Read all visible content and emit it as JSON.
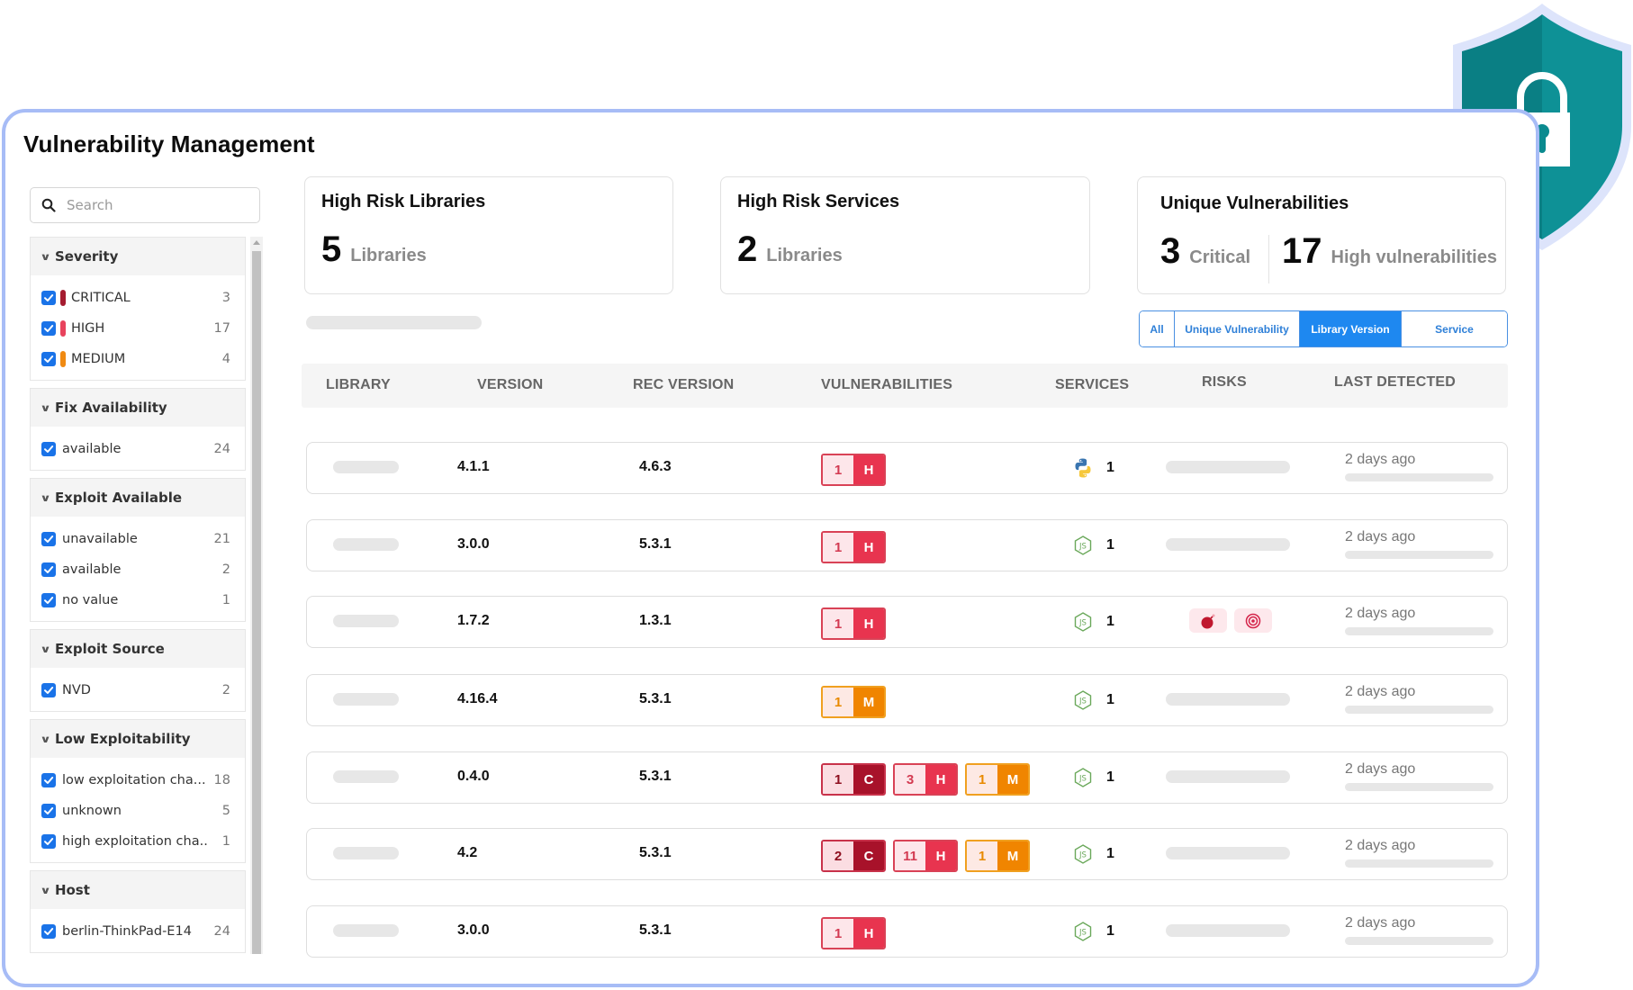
{
  "page": {
    "title": "Vulnerability Management"
  },
  "search": {
    "placeholder": "Search",
    "value": ""
  },
  "filters": [
    {
      "title": "Severity",
      "items": [
        {
          "label": "CRITICAL",
          "count": "3",
          "checked": true,
          "color": "#a51c30"
        },
        {
          "label": "HIGH",
          "count": "17",
          "checked": true,
          "color": "#e8435d"
        },
        {
          "label": "MEDIUM",
          "count": "4",
          "checked": true,
          "color": "#f08a12"
        }
      ]
    },
    {
      "title": "Fix Availability",
      "items": [
        {
          "label": "available",
          "count": "24",
          "checked": true
        }
      ]
    },
    {
      "title": "Exploit Available",
      "items": [
        {
          "label": "unavailable",
          "count": "21",
          "checked": true
        },
        {
          "label": "available",
          "count": "2",
          "checked": true
        },
        {
          "label": "no value",
          "count": "1",
          "checked": true
        }
      ]
    },
    {
      "title": "Exploit Source",
      "items": [
        {
          "label": "NVD",
          "count": "2",
          "checked": true
        }
      ]
    },
    {
      "title": "Low Exploitability",
      "items": [
        {
          "label": "low exploitation cha...",
          "count": "18",
          "checked": true
        },
        {
          "label": "unknown",
          "count": "5",
          "checked": true
        },
        {
          "label": "high exploitation cha...",
          "count": "1",
          "checked": true
        }
      ]
    },
    {
      "title": "Host",
      "items": [
        {
          "label": "berlin-ThinkPad-E14",
          "count": "24",
          "checked": true
        }
      ]
    }
  ],
  "cards": {
    "libraries": {
      "title": "High Risk Libraries",
      "value": "5",
      "unit": "Libraries"
    },
    "services": {
      "title": "High Risk Services",
      "value": "2",
      "unit": "Libraries"
    },
    "unique": {
      "title": "Unique Vulnerabilities",
      "critical_value": "3",
      "critical_label": "Critical",
      "high_value": "17",
      "high_label": "High vulnerabilities"
    }
  },
  "tabs": [
    {
      "label": "All",
      "active": false
    },
    {
      "label": "Unique Vulnerability",
      "active": false
    },
    {
      "label": "Library Version",
      "active": true
    },
    {
      "label": "Service",
      "active": false
    }
  ],
  "table": {
    "columns": [
      "LIBRARY",
      "VERSION",
      "REC VERSION",
      "VULNERABILITIES",
      "SERVICES",
      "RISKS",
      "LAST DETECTED"
    ],
    "rows": [
      {
        "version": "4.1.1",
        "rec_version": "4.6.3",
        "vulns": [
          {
            "count": "1",
            "sev": "H"
          }
        ],
        "service_icon": "python-icon",
        "services": "1",
        "risks": [],
        "last_detected": "2 days ago"
      },
      {
        "version": "3.0.0",
        "rec_version": "5.3.1",
        "vulns": [
          {
            "count": "1",
            "sev": "H"
          }
        ],
        "service_icon": "nodejs-icon",
        "services": "1",
        "risks": [],
        "last_detected": "2 days ago"
      },
      {
        "version": "1.7.2",
        "rec_version": "1.3.1",
        "vulns": [
          {
            "count": "1",
            "sev": "H"
          }
        ],
        "service_icon": "nodejs-icon",
        "services": "1",
        "risks": [
          "bomb-icon",
          "target-icon"
        ],
        "last_detected": "2 days ago"
      },
      {
        "version": "4.16.4",
        "rec_version": "5.3.1",
        "vulns": [
          {
            "count": "1",
            "sev": "M"
          }
        ],
        "service_icon": "nodejs-icon",
        "services": "1",
        "risks": [],
        "last_detected": "2 days ago"
      },
      {
        "version": "0.4.0",
        "rec_version": "5.3.1",
        "vulns": [
          {
            "count": "1",
            "sev": "C"
          },
          {
            "count": "3",
            "sev": "H"
          },
          {
            "count": "1",
            "sev": "M"
          }
        ],
        "service_icon": "nodejs-icon",
        "services": "1",
        "risks": [],
        "last_detected": "2 days ago"
      },
      {
        "version": "4.2",
        "rec_version": "5.3.1",
        "vulns": [
          {
            "count": "2",
            "sev": "C"
          },
          {
            "count": "11",
            "sev": "H"
          },
          {
            "count": "1",
            "sev": "M"
          }
        ],
        "service_icon": "nodejs-icon",
        "services": "1",
        "risks": [],
        "last_detected": "2 days ago"
      },
      {
        "version": "3.0.0",
        "rec_version": "5.3.1",
        "vulns": [
          {
            "count": "1",
            "sev": "H"
          }
        ],
        "service_icon": "nodejs-icon",
        "services": "1",
        "risks": [],
        "last_detected": "2 days ago"
      }
    ]
  },
  "severity_colors": {
    "C": {
      "border": "#c8324a",
      "num_bg": "#fbdde2",
      "num_color": "#8e1020",
      "sev_bg": "#a8122a"
    },
    "H": {
      "border": "#d94256",
      "num_bg": "#fde6ea",
      "num_color": "#d33a52",
      "sev_bg": "#e8344f"
    },
    "M": {
      "border": "#f0a020",
      "num_bg": "#fde9e4",
      "num_color": "#e88a00",
      "sev_bg": "#f08500"
    }
  },
  "colors": {
    "accent": "#1e88f0",
    "frame": "#a7bcf6",
    "shield": "#0b8a8f"
  }
}
